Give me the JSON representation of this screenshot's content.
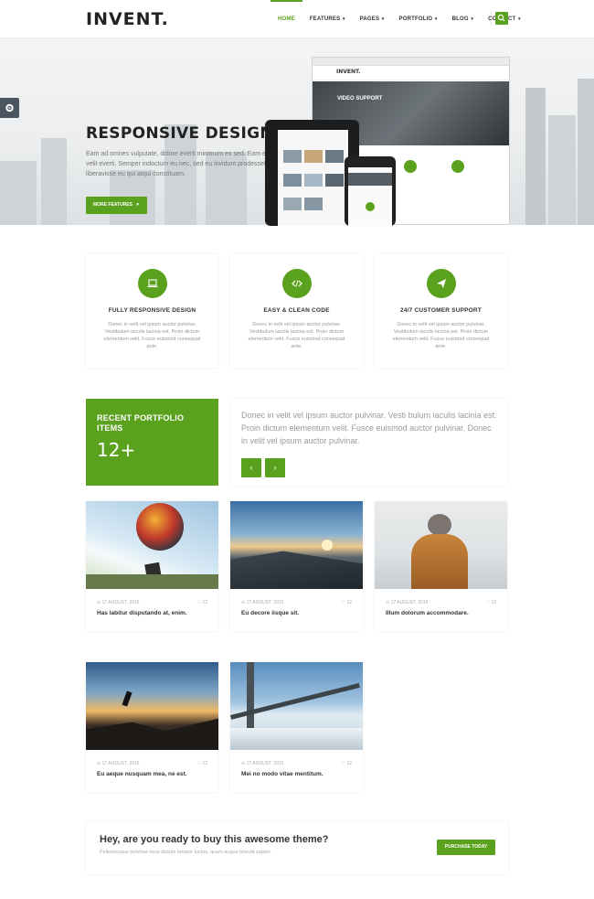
{
  "brand": {
    "logo": "INVENT.",
    "accent": "#5aa11e"
  },
  "nav": {
    "items": [
      {
        "label": "HOME",
        "active": true,
        "dropdown": false
      },
      {
        "label": "FEATURES",
        "dropdown": true
      },
      {
        "label": "PAGES",
        "dropdown": true
      },
      {
        "label": "PORTFOLIO",
        "dropdown": true
      },
      {
        "label": "BLOG",
        "dropdown": true
      },
      {
        "label": "CONTACT",
        "dropdown": true
      }
    ],
    "search_icon": "search-icon"
  },
  "hero": {
    "title": "RESPONSIVE DESIGN",
    "text": "Eam ad omnes vulputate, dolore everti minimum ex sed. Eam et velit everti. Semper indoctum eu nec, sed eu invidunt prodesset liberavisse eu qui atqui constituam.",
    "button": "MORE FEATURES",
    "device_logo": "INVENT.",
    "device_headline": "VIDEO SUPPORT"
  },
  "features": [
    {
      "icon": "laptop-icon",
      "title": "FULLY RESPONSIVE DESIGN",
      "text": "Donec in velit vel ipsum auctor pulvinar. Vestibulum iaculis lacinia est. Proin dictum elementum velit. Fusce euismod consequat ante."
    },
    {
      "icon": "code-icon",
      "title": "EASY & CLEAN CODE",
      "text": "Donec in velit vel ipsum auctor pulvinar. Vestibulum iaculis lacinia est. Proin dictum elementum velit. Fusce euismod consequat ante."
    },
    {
      "icon": "paper-plane-icon",
      "title": "24/7 CUSTOMER SUPPORT",
      "text": "Donec in velit vel ipsum auctor pulvinar. Vestibulum iaculis lacinia est. Proin dictum elementum velit. Fusce euismod consequat ante."
    }
  ],
  "portfolio": {
    "heading": "RECENT PORTFOLIO ITEMS",
    "count": "12+",
    "intro": "Donec in velit vel ipsum auctor pulvinar. Vesti bulum iaculis lacinia est. Proin dictum elementum velit. Fusce euismod auctor pulvinar. Donec in velit vel ipsum auctor pulvinar.",
    "prev_label": "‹",
    "next_label": "›",
    "items": [
      {
        "date": "17 AUGUST, 2015",
        "likes": "12",
        "title": "Has labitur disputando at, enim."
      },
      {
        "date": "17 AUGUST, 2015",
        "likes": "12",
        "title": "Eu decore iisque sit."
      },
      {
        "date": "17 AUGUST, 2015",
        "likes": "12",
        "title": "Illum dolorum accommodare."
      },
      {
        "date": "17 AUGUST, 2015",
        "likes": "12",
        "title": "Eu aeque nusquam mea, ne est."
      },
      {
        "date": "17 AUGUST, 2015",
        "likes": "12",
        "title": "Mei no modo vitae mentitum."
      }
    ]
  },
  "cta": {
    "title": "Hey, are you ready to buy this awesome theme?",
    "subtitle": "Pellentesque pulvinar risus dictum tempor luctus, quam augue blandit sapien.",
    "button": "PURCHASE TODAY"
  }
}
